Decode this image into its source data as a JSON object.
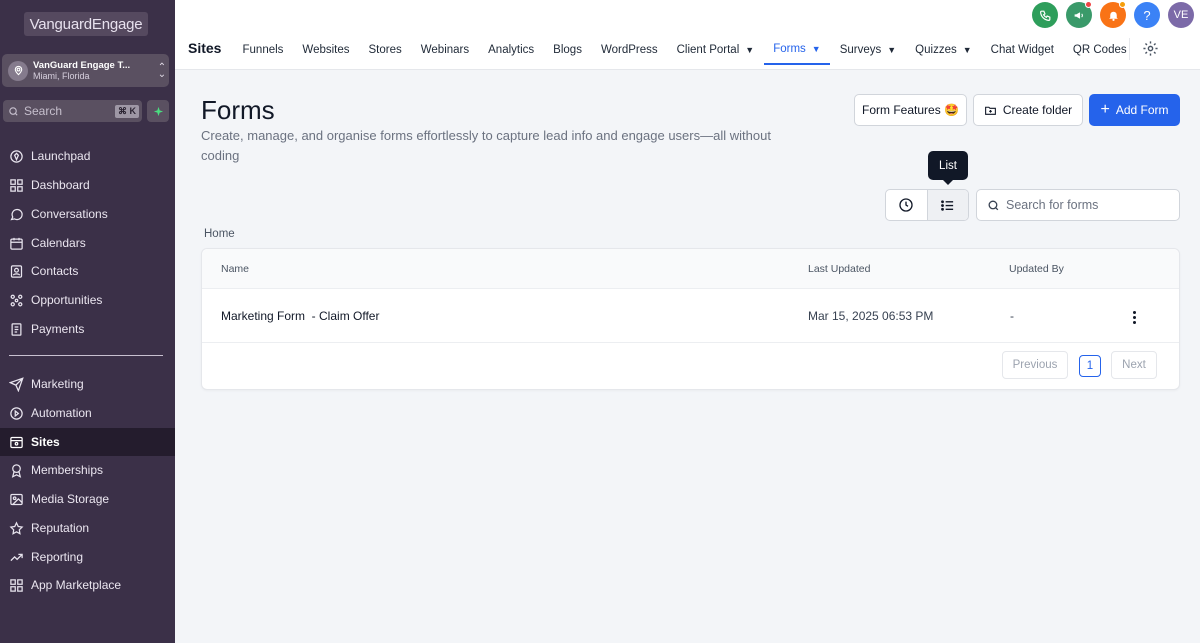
{
  "sidebar": {
    "logo": "VanguardEngage",
    "account": {
      "name": "VanGuard Engage T...",
      "location": "Miami, Florida"
    },
    "search": {
      "placeholder": "Search",
      "shortcut": "⌘ K"
    },
    "items": [
      {
        "label": "Launchpad",
        "icon": "rocket-icon"
      },
      {
        "label": "Dashboard",
        "icon": "grid-icon"
      },
      {
        "label": "Conversations",
        "icon": "chat-icon"
      },
      {
        "label": "Calendars",
        "icon": "calendar-icon"
      },
      {
        "label": "Contacts",
        "icon": "contacts-icon"
      },
      {
        "label": "Opportunities",
        "icon": "opportunities-icon"
      },
      {
        "label": "Payments",
        "icon": "payments-icon"
      },
      {
        "label": "Marketing",
        "icon": "send-icon"
      },
      {
        "label": "Automation",
        "icon": "automation-icon"
      },
      {
        "label": "Sites",
        "icon": "sites-icon",
        "active": true
      },
      {
        "label": "Memberships",
        "icon": "membership-icon"
      },
      {
        "label": "Media Storage",
        "icon": "media-icon"
      },
      {
        "label": "Reputation",
        "icon": "star-icon"
      },
      {
        "label": "Reporting",
        "icon": "trend-icon"
      },
      {
        "label": "App Marketplace",
        "icon": "apps-icon"
      }
    ]
  },
  "topbar": {
    "title": "Sites",
    "tabs": [
      "Funnels",
      "Websites",
      "Stores",
      "Webinars",
      "Analytics",
      "Blogs",
      "WordPress",
      "Client Portal",
      "Forms",
      "Surveys",
      "Quizzes",
      "Chat Widget",
      "QR Codes"
    ],
    "active_tab": "Forms",
    "avatar_initials": "VE",
    "help_glyph": "?",
    "colors": {
      "phone": "#2e9e5b",
      "megaphone": "#3a9a6a",
      "bell": "#f97316",
      "help": "#3b82f6",
      "avatar": "#7c6aa8",
      "accent": "#2563eb"
    }
  },
  "main": {
    "title": "Forms",
    "subtitle": "Create, manage, and organise forms effortlessly to capture lead info and engage users—all without coding",
    "buttons": {
      "features": "Form Features 🤩",
      "create_folder": "Create folder",
      "add_form": "Add Form"
    },
    "tooltip": "List",
    "search_placeholder": "Search for forms",
    "breadcrumb": "Home",
    "table": {
      "headers": [
        "Name",
        "Last Updated",
        "Updated By"
      ],
      "rows": [
        {
          "name": "Marketing Form  - Claim Offer",
          "updated": "Mar 15, 2025 06:53 PM",
          "by": "-"
        }
      ]
    },
    "pagination": {
      "previous": "Previous",
      "page": "1",
      "next": "Next"
    }
  }
}
